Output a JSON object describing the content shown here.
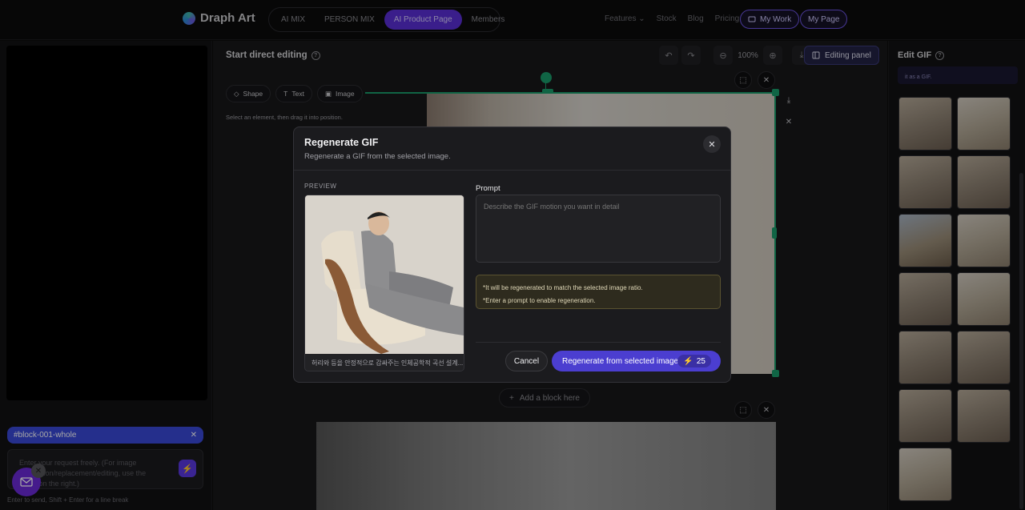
{
  "header": {
    "brand": "Draph Art",
    "nav": [
      "AI MIX",
      "PERSON MIX",
      "AI Product Page",
      "Members"
    ],
    "active_nav": "AI Product Page",
    "links": {
      "features": "Features",
      "stock": "Stock",
      "blog": "Blog",
      "pricing": "Pricing"
    },
    "my_work": "My Work",
    "my_page": "My Page"
  },
  "left": {
    "tag": "#block-001-whole",
    "request_placeholder": "Enter your request freely. (For image generation/replacement/editing, use the panel on the right.)",
    "hint": "Enter to send, Shift + Enter for a line break"
  },
  "editor": {
    "title": "Start direct editing",
    "zoom": "100%",
    "editing_panel": "Editing panel",
    "tools": {
      "shape": "Shape",
      "text": "Text",
      "image": "Image"
    },
    "tool_hint": "Select an element, then drag it into position.",
    "add_block": "Add a block here"
  },
  "right": {
    "title": "Edit GIF",
    "strip_text": "it as a GIF."
  },
  "modal": {
    "title": "Regenerate GIF",
    "subtitle": "Regenerate a GIF from the selected image.",
    "preview_label": "PREVIEW",
    "caption": "허리와 등을 안정적으로 감싸주는 인체공학적 곡선 설계...",
    "prompt_label": "Prompt",
    "prompt_placeholder": "Describe the GIF motion you want in detail",
    "notice_1": "*It will be regenerated to match the selected image ratio.",
    "notice_2": "*Enter a prompt to enable regeneration.",
    "cancel": "Cancel",
    "regenerate": "Regenerate from selected image",
    "cost": "25"
  },
  "colors": {
    "accent": "#4b3ed0",
    "selection": "#1a9c6a",
    "tag": "#3a49d8"
  }
}
